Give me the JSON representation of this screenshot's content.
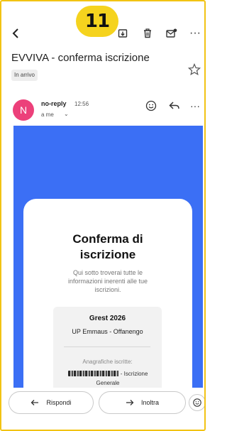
{
  "badge": {
    "number": "11"
  },
  "toolbar": {
    "back_icon": "arrow-back-icon",
    "archive_icon": "archive-icon",
    "delete_icon": "trash-icon",
    "mark_unread_icon": "mail-unread-icon",
    "more_label": "···"
  },
  "email": {
    "subject": "EVVIVA - conferma iscrizione",
    "label": "In arrivo",
    "sender": {
      "avatar_letter": "N",
      "name": "no-reply",
      "time": "12:56",
      "recipient": "a me",
      "recipient_chevron": "⌄"
    },
    "more_label": "···"
  },
  "body": {
    "title_line1": "Conferma di",
    "title_line2": "iscrizione",
    "subtitle": "Qui sotto troverai tutte le informazioni inerenti alle tue iscrizioni.",
    "event": "Grest 2026",
    "parish": "UP Emmaus - Offanengo",
    "registrations_label": "Anagrafiche iscritte:",
    "registration_suffix": " - Iscrizione Generale"
  },
  "actions": {
    "reply_label": "Rispondi",
    "forward_label": "Inoltra"
  },
  "colors": {
    "accent_border": "#f2c313",
    "badge_yellow": "#f5d31e",
    "email_blue": "#3b6ff5",
    "avatar_pink": "#ec407a"
  }
}
